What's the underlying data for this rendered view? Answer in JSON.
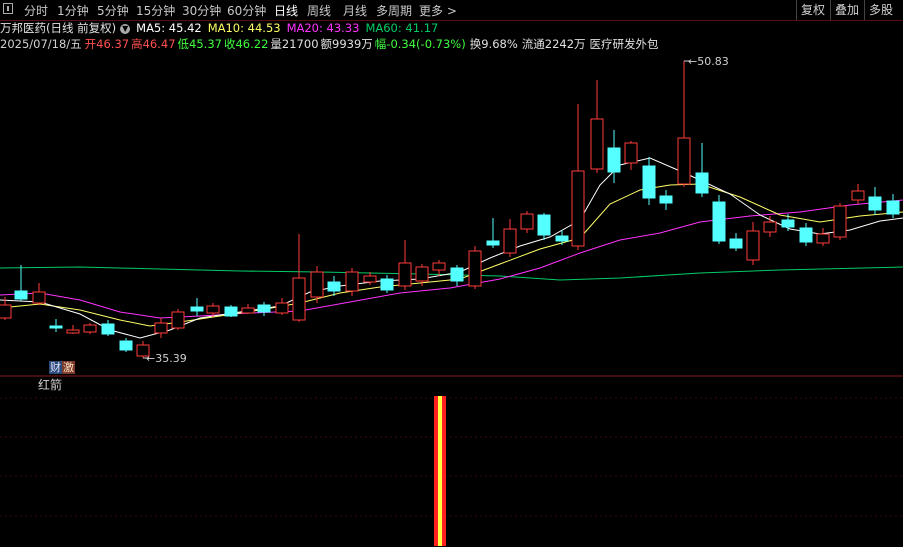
{
  "toolbar": {
    "tabs": [
      {
        "label": "分时"
      },
      {
        "label": "1分钟"
      },
      {
        "label": "5分钟"
      },
      {
        "label": "15分钟"
      },
      {
        "label": "30分钟"
      },
      {
        "label": "60分钟"
      },
      {
        "label": "日线"
      },
      {
        "label": "周线"
      },
      {
        "label": "月线"
      },
      {
        "label": "多周期"
      },
      {
        "label": "更多"
      }
    ],
    "active_tab": "日线",
    "right_buttons": [
      {
        "label": "复权"
      },
      {
        "label": "叠加"
      },
      {
        "label": "多股"
      }
    ]
  },
  "header": {
    "stock_name": "万邦医药(日线 前复权)",
    "ma5": "MA5: 45.42",
    "ma10": "MA10: 44.53",
    "ma20": "MA20: 43.33",
    "ma60": "MA60: 41.17",
    "date": "2025/07/18/五",
    "open": "开46.37",
    "high": "高46.47",
    "low": "低45.37",
    "close": "收46.22",
    "volume": "量21700",
    "amount": "额9939万",
    "change": "幅-0.34(-0.73%)",
    "turnover": "换9.68%",
    "float": "流通2242万",
    "sector": "医疗研发外包"
  },
  "chart": {
    "high_label": "50.83",
    "low_label": "35.39",
    "badge_left": "财",
    "badge_right": "激",
    "indicator_name": "红箭"
  },
  "colors": {
    "up": "#ff3c3c",
    "down": "#54ffff",
    "ma5": "#ffffff",
    "ma10": "#ffff66",
    "ma20": "#ff33ff",
    "ma60": "#00cc66",
    "panel_border": "#8a1a1a",
    "signal_red": "#ff2020",
    "signal_yellow": "#ffff40"
  }
}
